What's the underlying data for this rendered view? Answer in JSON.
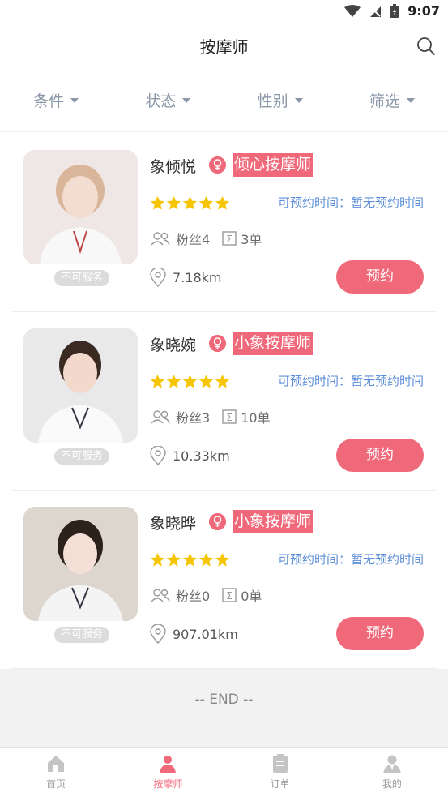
{
  "status_bar": {
    "time": "9:07"
  },
  "header": {
    "title": "按摩师"
  },
  "filters": [
    {
      "label": "条件"
    },
    {
      "label": "状态"
    },
    {
      "label": "性别"
    },
    {
      "label": "筛选"
    }
  ],
  "therapists": [
    {
      "name": "象倾悦",
      "shop": "倾心按摩师",
      "rating": 5,
      "available_time": "可预约时间：暂无预约时间",
      "fans": "粉丝4",
      "orders": "3单",
      "distance": "7.18km",
      "status": "不可服务",
      "book_label": "预约"
    },
    {
      "name": "象晓婉",
      "shop": "小象按摩师",
      "rating": 5,
      "available_time": "可预约时间：暂无预约时间",
      "fans": "粉丝3",
      "orders": "10单",
      "distance": "10.33km",
      "status": "不可服务",
      "book_label": "预约"
    },
    {
      "name": "象晓晔",
      "shop": "小象按摩师",
      "rating": 5,
      "available_time": "可预约时间：暂无预约时间",
      "fans": "粉丝0",
      "orders": "0单",
      "distance": "907.01km",
      "status": "不可服务",
      "book_label": "预约"
    }
  ],
  "end_text": "-- END --",
  "bottom_nav": [
    {
      "label": "首页",
      "icon": "home-icon",
      "active": false
    },
    {
      "label": "按摩师",
      "icon": "therapist-icon",
      "active": true
    },
    {
      "label": "订单",
      "icon": "order-icon",
      "active": false
    },
    {
      "label": "我的",
      "icon": "profile-icon",
      "active": false
    }
  ],
  "colors": {
    "accent": "#f0697a",
    "link": "#5d8fd8",
    "star": "#f6c500",
    "filter": "#8a97a8"
  }
}
